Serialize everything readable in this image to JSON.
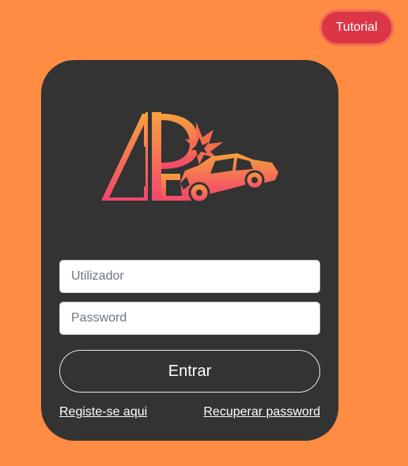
{
  "header": {
    "tutorial_label": "Tutorial"
  },
  "login": {
    "username_placeholder": "Utilizador",
    "password_placeholder": "Password",
    "submit_label": "Entrar",
    "register_link": "Registe-se aqui",
    "recover_link": "Recuperar password"
  },
  "logo": {
    "icon": "accident-car-logo-icon",
    "gradient_start": "#f7a13c",
    "gradient_end": "#f3466d"
  },
  "colors": {
    "background": "#ff8c42",
    "card": "#333333",
    "tutorial_button": "#dc3545"
  }
}
